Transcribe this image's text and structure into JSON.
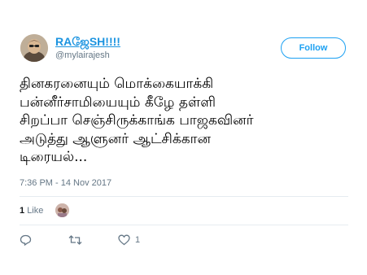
{
  "author": {
    "display_name": "RAஜேSH!!!!",
    "handle": "@mylairajesh"
  },
  "follow_button": {
    "label": "Follow"
  },
  "tweet": {
    "lines": [
      "தினகரனையும் மொக்கையாக்கி",
      "பன்னீர்சாமியையும் கீழே தள்ளி",
      "சிறப்பா செஞ்சிருக்காங்க பாஜகவினர்",
      "அடுத்து ஆளுனர் ஆட்சிக்கான",
      "டிரையல்..."
    ],
    "timestamp": "7:36 PM - 14 Nov 2017"
  },
  "engagement": {
    "likes_number": "1",
    "likes_word": "Like"
  },
  "actions": {
    "reply": {
      "icon": "reply-icon"
    },
    "retweet": {
      "icon": "retweet-icon"
    },
    "like": {
      "icon": "heart-icon",
      "count": "1"
    }
  },
  "colors": {
    "accent": "#1da1f2",
    "name_link": "#1c94e0",
    "muted": "#657786"
  }
}
